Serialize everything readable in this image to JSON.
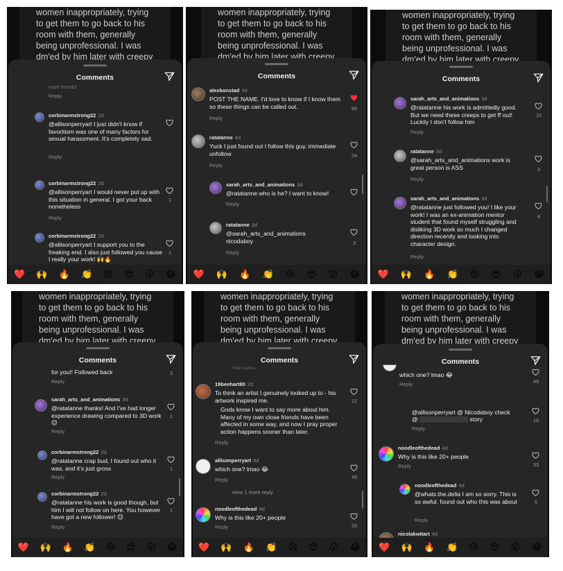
{
  "bg_text": "women inappropriately, trying to get them to go back to his room with them, generally being unprofessional. I was dm'ed by him later with creepy",
  "header_title": "Comments",
  "emoji_bar": [
    "❤️",
    "🙌",
    "🔥",
    "👏",
    "😢",
    "😍",
    "😮",
    "😂"
  ],
  "p1": {
    "partial": "more friends!",
    "reply": "Reply",
    "c1": {
      "user": "corbinarmstrong22",
      "time": "2d",
      "text": "@allisonperryart I just didn't know if favoritism was one of many factors for sexual harassment. It's completely sad."
    },
    "c2": {
      "user": "corbinarmstrong22",
      "time": "2d",
      "text": "@allisonperryart I would never put up with this situation in general. I got your back nonetheless",
      "count": "1"
    },
    "c3": {
      "user": "corbinarmstrong22",
      "time": "2d",
      "text": "@allisonperryart I support you to the freaking end. I also just followed you cause I really your work! 🙌🔥",
      "count": "1"
    }
  },
  "p2": {
    "reply": "Reply",
    "c1": {
      "user": "alexkonstad",
      "time": "4d",
      "text": "POST THE NAME. I'd love to know if I know them so these things can be called out.",
      "count": "96"
    },
    "c2": {
      "user": "ratatanne",
      "time": "4d",
      "text": "Yuck I just found out I follow this guy, immediate unfollow",
      "count": "34"
    },
    "c3": {
      "user": "sarah_arts_and_animations",
      "time": "3d",
      "text": "@ratatanne who is he? I want to know!"
    },
    "c4": {
      "user": "ratatanne",
      "time": "3d",
      "text": "@sarah_arts_and_animations nicodaboy",
      "count": "3"
    }
  },
  "p3": {
    "reply": "Reply",
    "c1": {
      "user": "sarah_arts_and_animations",
      "time": "3d",
      "text": "@ratatanne his work is admittedly good. But we need these creeps to get ff out! Luckily I don't follow him",
      "count": "10"
    },
    "c2": {
      "user": "ratatanne",
      "time": "3d",
      "text": "@sarah_arts_and_animations work is great person is ASS",
      "count": "3"
    },
    "c3": {
      "user": "sarah_arts_and_animations",
      "time": "3d",
      "text": "@ratatanne just followed you! I like your work! I was an ex-animation mentor student that found myself struggling and disliking 3D work so much I changed direction recently and looking into character design.",
      "count": "4"
    }
  },
  "p4": {
    "partial": "for you!! Followed back",
    "partial_count": "3",
    "reply": "Reply",
    "c1": {
      "user": "sarah_arts_and_animations",
      "time": "3d",
      "text": "@ratatanne thanks! And I've had longer experience drawing compared to 3D work 😊",
      "count": "1"
    },
    "c2": {
      "user": "corbinarmstrong22",
      "time": "2d",
      "text": "@ratatanne crap bud, I found out who it was, and it's just gross",
      "count": "1"
    },
    "c3": {
      "user": "corbinarmstrong22",
      "time": "2d",
      "text": "@ratatanne his work is good though, but him I will not follow on here. You however have got a new follower! 😊",
      "count": "1"
    }
  },
  "p5": {
    "partial": "Hide replies",
    "reply": "Reply",
    "c1": {
      "user": "19beehart80",
      "time": "2d",
      "text": "To think an artist I genuinely looked up to - his artwork inspired me.",
      "text2": "Gods know I want to say more about him. Many of my own close friends have been affected in some way, and now I pray proper action happens sooner than later.",
      "count": "12"
    },
    "c2": {
      "user": "allisonperryart",
      "time": "4d",
      "text": "which one? lmao 😂",
      "count": "49"
    },
    "view_more": "View 1 more reply",
    "c3": {
      "user": "noodleofthedead",
      "time": "4d",
      "text": "Why is this like 20+ people",
      "count": "33"
    }
  },
  "p6": {
    "reply": "Reply",
    "c1": {
      "text": "which one? lmao 😂",
      "count": "49"
    },
    "c2": {
      "text": "@allisonperryart @ Nicodaboy check",
      "text2b": "story",
      "count": "16"
    },
    "c3": {
      "user": "noodleofthedead",
      "time": "4d",
      "text": "Why is this like 20+ people",
      "count": "33"
    },
    "c4": {
      "user": "noodleofthedead",
      "time": "4d",
      "text": "@whats.the.delia I am so sorry. This is so awful, found out who this was about",
      "count": "5"
    },
    "c5": {
      "user": "nicolakwitart",
      "time": "4d"
    }
  }
}
